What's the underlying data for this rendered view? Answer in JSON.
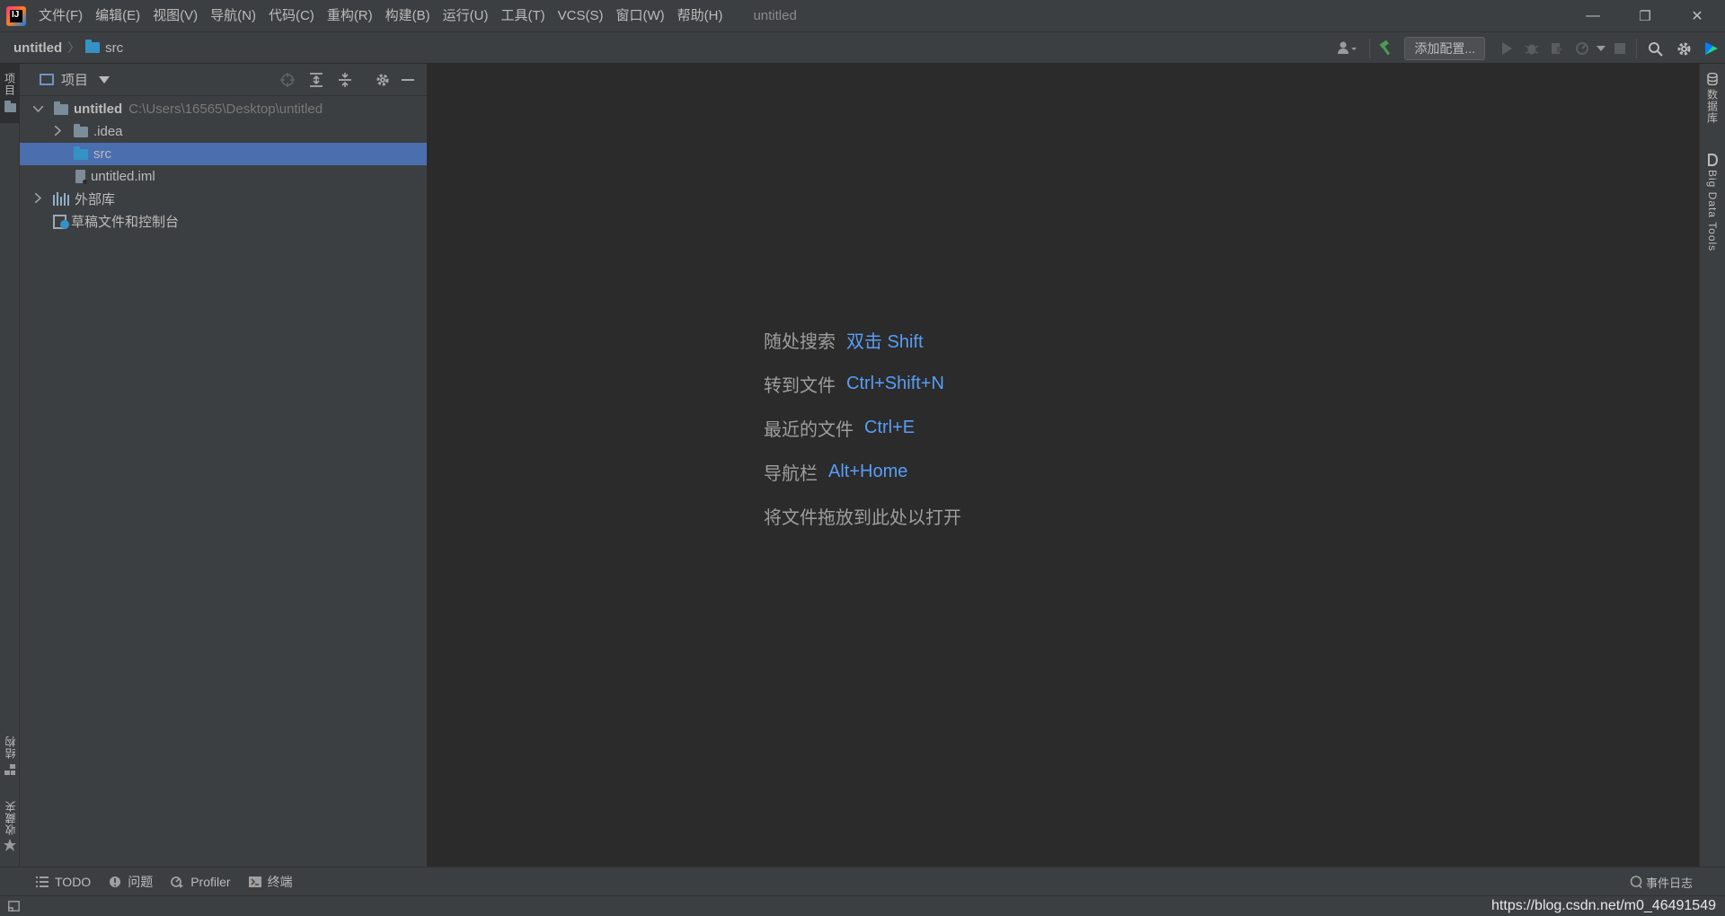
{
  "titlebar": {
    "menu": [
      "文件(F)",
      "编辑(E)",
      "视图(V)",
      "导航(N)",
      "代码(C)",
      "重构(R)",
      "构建(B)",
      "运行(U)",
      "工具(T)",
      "VCS(S)",
      "窗口(W)",
      "帮助(H)"
    ],
    "window_title": "untitled",
    "minimize_glyph": "—",
    "restore_glyph": "❐",
    "close_glyph": "✕"
  },
  "navbar": {
    "project": "untitled",
    "separator": "〉",
    "folder": "src",
    "add_config_label": "添加配置..."
  },
  "left_strip": {
    "project_tab": "项目",
    "structure_tab": "结构",
    "favorites_tab": "收藏夹"
  },
  "project_panel": {
    "title": "项目",
    "tree": {
      "root_name": "untitled",
      "root_path": "C:\\Users\\16565\\Desktop\\untitled",
      "idea": ".idea",
      "src": "src",
      "iml": "untitled.iml",
      "external_libs": "外部库",
      "scratches": "草稿文件和控制台"
    }
  },
  "editor_hints": [
    {
      "label": "随处搜索",
      "key": "双击 Shift"
    },
    {
      "label": "转到文件",
      "key": "Ctrl+Shift+N"
    },
    {
      "label": "最近的文件",
      "key": "Ctrl+E"
    },
    {
      "label": "导航栏",
      "key": "Alt+Home"
    },
    {
      "label": "将文件拖放到此处以打开",
      "key": ""
    }
  ],
  "right_strip": {
    "database_tab": "数据库",
    "bigdata_tab": "Big Data Tools"
  },
  "bottom_tools": {
    "todo": "TODO",
    "problems": "问题",
    "profiler": "Profiler",
    "terminal": "终端",
    "event_log": "事件日志"
  },
  "watermark": "https://blog.csdn.net/m0_46491549",
  "colors": {
    "accent_selected": "#4b6eaf",
    "shortcut_blue": "#589df6",
    "folder_blue": "#3592c4",
    "build_green": "#499c54"
  }
}
